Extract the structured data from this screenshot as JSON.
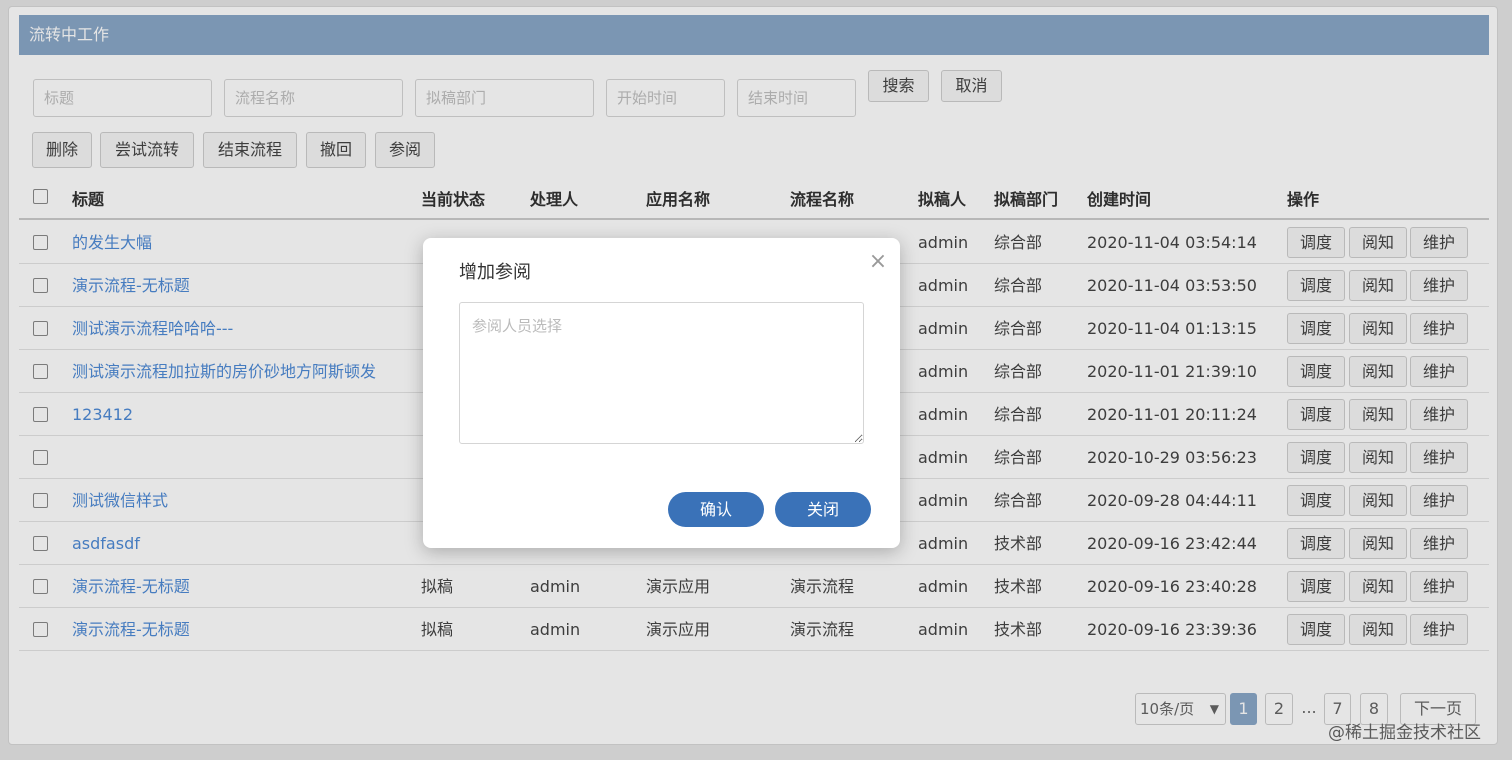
{
  "header": {
    "title": "流转中工作"
  },
  "search": {
    "title_placeholder": "标题",
    "flow_name_placeholder": "流程名称",
    "dept_placeholder": "拟稿部门",
    "start_placeholder": "开始时间",
    "end_placeholder": "结束时间",
    "search_label": "搜索",
    "cancel_label": "取消"
  },
  "toolbar": {
    "delete_label": "删除",
    "try_flow_label": "尝试流转",
    "end_flow_label": "结束流程",
    "withdraw_label": "撤回",
    "review_label": "参阅"
  },
  "table": {
    "columns": [
      "标题",
      "当前状态",
      "处理人",
      "应用名称",
      "流程名称",
      "拟稿人",
      "拟稿部门",
      "创建时间",
      "操作"
    ],
    "actions": [
      "调度",
      "阅知",
      "维护"
    ],
    "rows": [
      {
        "title": "的发生大幅",
        "status": "",
        "handler": "",
        "app": "",
        "flow": "",
        "drafter": "admin",
        "dept": "综合部",
        "created": "2020-11-04 03:54:14"
      },
      {
        "title": "演示流程-无标题",
        "status": "",
        "handler": "",
        "app": "",
        "flow": "",
        "drafter": "admin",
        "dept": "综合部",
        "created": "2020-11-04 03:53:50"
      },
      {
        "title": "测试演示流程哈哈哈---",
        "status": "",
        "handler": "",
        "app": "",
        "flow": "",
        "drafter": "admin",
        "dept": "综合部",
        "created": "2020-11-04 01:13:15"
      },
      {
        "title": "测试演示流程加拉斯的房价砂地方阿斯顿发",
        "status": "",
        "handler": "",
        "app": "",
        "flow": "",
        "drafter": "admin",
        "dept": "综合部",
        "created": "2020-11-01 21:39:10"
      },
      {
        "title": "123412",
        "status": "",
        "handler": "",
        "app": "",
        "flow": "",
        "drafter": "admin",
        "dept": "综合部",
        "created": "2020-11-01 20:11:24"
      },
      {
        "title": "",
        "status": "",
        "handler": "",
        "app": "",
        "flow": "",
        "drafter": "admin",
        "dept": "综合部",
        "created": "2020-10-29 03:56:23"
      },
      {
        "title": "测试微信样式",
        "status": "",
        "handler": "",
        "app": "",
        "flow": "",
        "drafter": "admin",
        "dept": "综合部",
        "created": "2020-09-28 04:44:11"
      },
      {
        "title": "asdfasdf",
        "status": "",
        "handler": "",
        "app": "",
        "flow": "",
        "drafter": "admin",
        "dept": "技术部",
        "created": "2020-09-16 23:42:44"
      },
      {
        "title": "演示流程-无标题",
        "status": "拟稿",
        "handler": "admin",
        "app": "演示应用",
        "flow": "演示流程",
        "drafter": "admin",
        "dept": "技术部",
        "created": "2020-09-16 23:40:28"
      },
      {
        "title": "演示流程-无标题",
        "status": "拟稿",
        "handler": "admin",
        "app": "演示应用",
        "flow": "演示流程",
        "drafter": "admin",
        "dept": "技术部",
        "created": "2020-09-16 23:39:36"
      }
    ]
  },
  "pager": {
    "page_size": "10条/页",
    "pages": [
      "1",
      "2",
      "...",
      "7",
      "8"
    ],
    "current": "1",
    "next_label": "下一页"
  },
  "modal": {
    "title": "增加参阅",
    "close_glyph": "×",
    "textarea_placeholder": "参阅人员选择",
    "confirm_label": "确认",
    "close_label": "关闭"
  },
  "watermark": "@稀土掘金技术社区",
  "colors": {
    "header_bg": "#8aa7c8",
    "link": "#4f8bd6",
    "primary": "#3a72b8",
    "pager_active": "#8aa7c8"
  }
}
